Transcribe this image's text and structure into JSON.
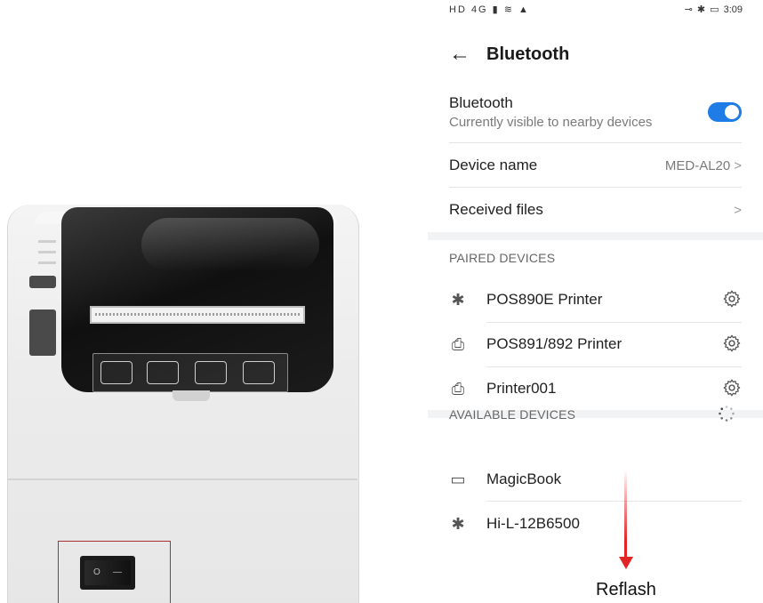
{
  "photo": {
    "switch_on_symbol": "O",
    "switch_off_symbol": "—"
  },
  "status_bar": {
    "left_icons": "HD 4G ▮ ≋ ▲",
    "right_icons": "⊸ ✱ ▭",
    "time": "3:09"
  },
  "header": {
    "back_icon": "arrow-left-icon",
    "title": "Bluetooth"
  },
  "bluetooth_toggle": {
    "label": "Bluetooth",
    "subtitle": "Currently visible to nearby devices",
    "enabled": true,
    "accent_color": "#1f7ce6"
  },
  "device_name": {
    "label": "Device name",
    "value": "MED-AL20",
    "chevron": ">"
  },
  "received_files": {
    "label": "Received files",
    "chevron": ">"
  },
  "paired_devices": {
    "header": "PAIRED DEVICES",
    "items": [
      {
        "name": "POS890E Printer",
        "icon": "bluetooth-icon",
        "glyph": "✱"
      },
      {
        "name": "POS891/892 Printer",
        "icon": "printer-icon",
        "glyph": "⎙"
      },
      {
        "name": "Printer001",
        "icon": "printer-icon",
        "glyph": "⎙"
      }
    ]
  },
  "available_devices": {
    "header": "AVAILABLE DEVICES",
    "items": [
      {
        "name": "MagicBook",
        "icon": "laptop-icon",
        "glyph": "▭"
      },
      {
        "name": "Hi-L-12B6500",
        "icon": "bluetooth-icon",
        "glyph": "✱"
      }
    ]
  },
  "annotation": {
    "label": "Reflash",
    "arrow_color": "#e22424",
    "box_color": "#a83232"
  }
}
